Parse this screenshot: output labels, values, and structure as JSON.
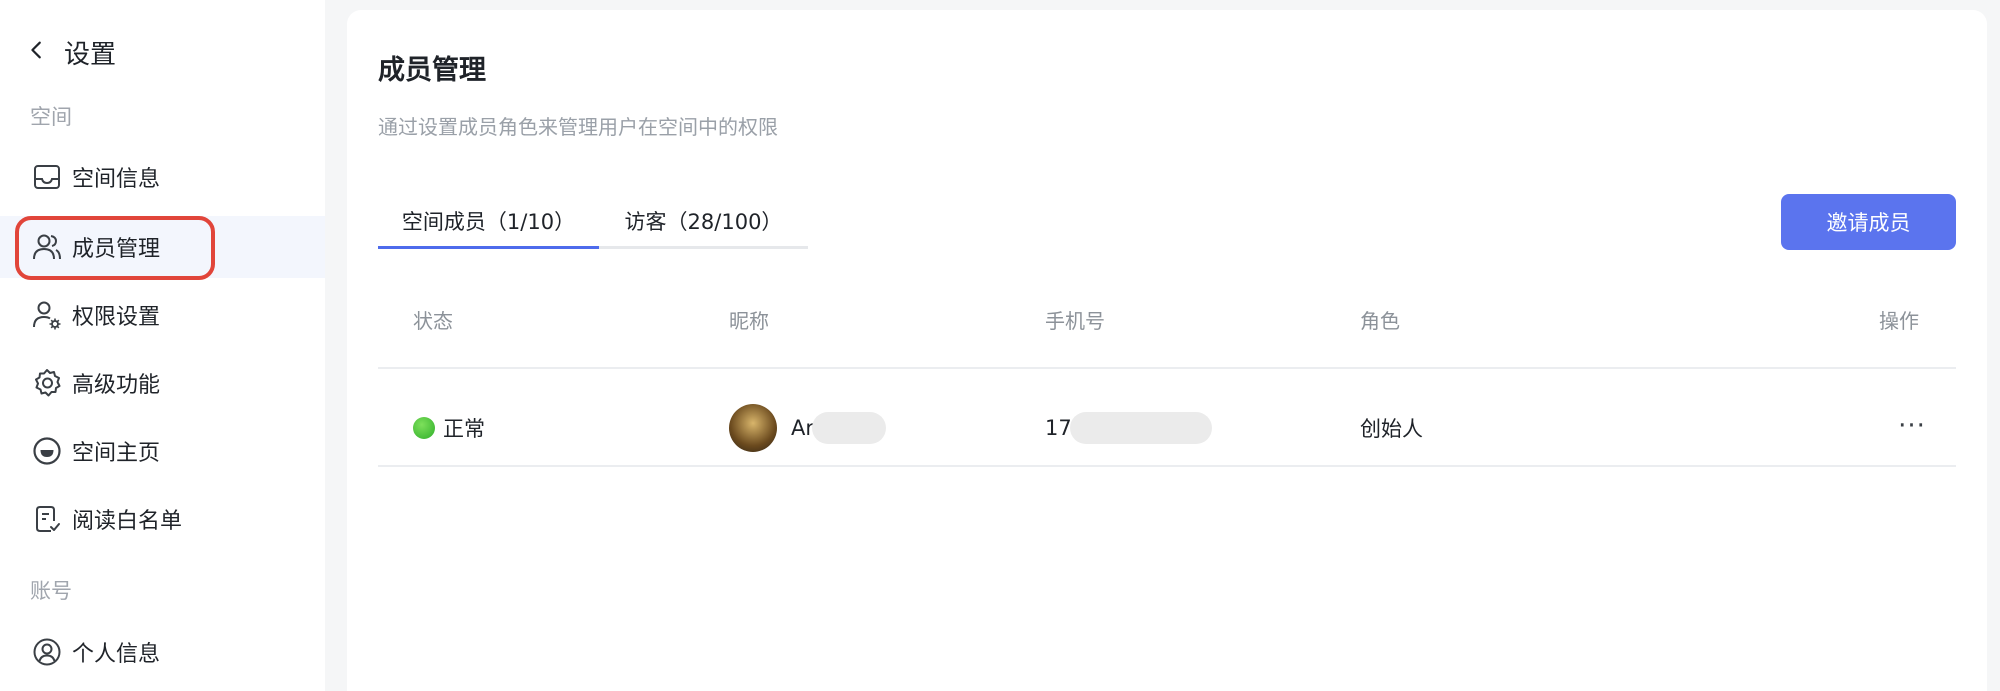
{
  "sidebar": {
    "title": "设置",
    "section_space": "空间",
    "section_account": "账号",
    "items": [
      {
        "label": "空间信息",
        "icon": "inbox-icon"
      },
      {
        "label": "成员管理",
        "icon": "users-icon",
        "active": true
      },
      {
        "label": "权限设置",
        "icon": "user-gear-icon"
      },
      {
        "label": "高级功能",
        "icon": "gear-icon"
      },
      {
        "label": "空间主页",
        "icon": "smile-icon"
      },
      {
        "label": "阅读白名单",
        "icon": "doc-check-icon"
      }
    ],
    "account_items": [
      {
        "label": "个人信息",
        "icon": "user-circle-icon"
      }
    ]
  },
  "main": {
    "title": "成员管理",
    "description": "通过设置成员角色来管理用户在空间中的权限",
    "tabs": [
      {
        "label": "空间成员（1/10）",
        "active": true
      },
      {
        "label": "访客（28/100）",
        "active": false
      }
    ],
    "invite_label": "邀请成员",
    "table": {
      "headers": [
        "状态",
        "昵称",
        "手机号",
        "角色",
        "操作"
      ],
      "rows": [
        {
          "status": "正常",
          "nickname": "Ar",
          "phone": "17",
          "role": "创始人",
          "action": "···"
        }
      ]
    }
  },
  "colors": {
    "accent": "#5b74ee",
    "highlight": "#e1453a",
    "status_ok": "#3cbf33"
  }
}
